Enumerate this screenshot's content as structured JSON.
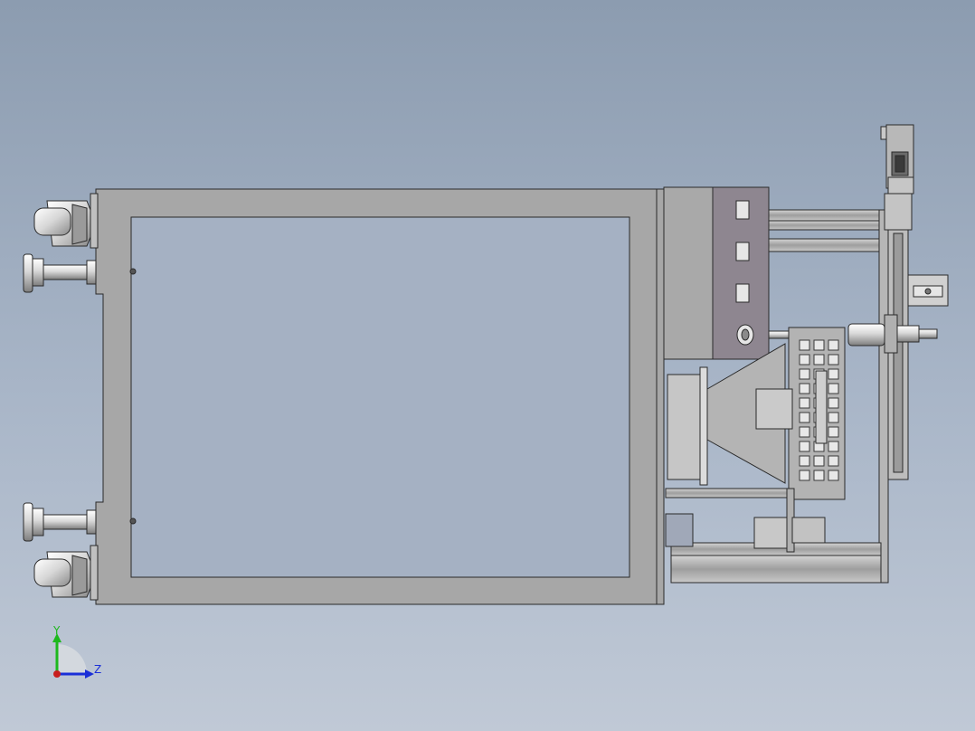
{
  "viewport": {
    "background_top": "#8c9cb0",
    "background_bottom": "#c0c9d6"
  },
  "triad": {
    "y_label": "Y",
    "z_label": "Z",
    "y_color": "#1db81d",
    "z_color": "#1a2fd8",
    "x_color": "#c81e1e"
  },
  "model": {
    "frame_color": "#a7a7a7",
    "panel_color": "#8e8690",
    "edge_color": "#2a2a2a"
  }
}
